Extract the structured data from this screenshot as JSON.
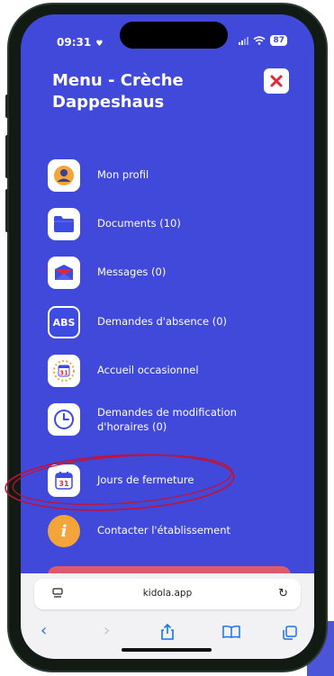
{
  "status_bar": {
    "time": "09:31",
    "battery": "87"
  },
  "header": {
    "title_line1": "Menu - Crèche",
    "title_line2": "Dappeshaus"
  },
  "close_button": {
    "glyph": "✕",
    "color": "#e0283a"
  },
  "menu": {
    "items": [
      {
        "label": "Mon profil",
        "icon": "profile-icon"
      },
      {
        "label": "Documents (10)",
        "icon": "folder-icon"
      },
      {
        "label": "Messages (0)",
        "icon": "envelope-icon"
      },
      {
        "label": "Demandes d'absence (0)",
        "icon": "abs-icon",
        "icon_text": "ABS"
      },
      {
        "label": "Accueil occasionnel",
        "icon": "dotted-calendar-icon",
        "icon_text": "31"
      },
      {
        "label_line1": "Demandes de modification",
        "label_line2": "d'horaires (0)",
        "icon": "clock-icon"
      },
      {
        "label": "Jours de fermeture",
        "icon": "calendar-icon",
        "icon_text": "31"
      },
      {
        "label": "Contacter l'établissement",
        "icon": "info-icon",
        "icon_text": "i"
      }
    ]
  },
  "browser": {
    "url": "kidola.app"
  },
  "colors": {
    "background": "#4149db",
    "accent_red": "#e0283a",
    "highlight": "#c8102e",
    "link_blue": "#1a73e8"
  }
}
